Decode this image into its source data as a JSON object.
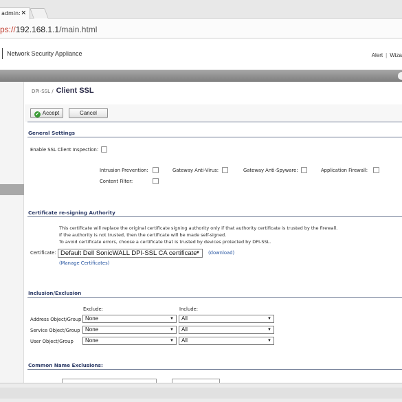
{
  "browser": {
    "tab_title": "admin:",
    "tab_close": "×",
    "url_scheme": "ps://",
    "url_host": "192.168.1.1",
    "url_path": "/main.html"
  },
  "header": {
    "app_title": "Network Security Appliance",
    "link_alert": "Alert",
    "link_separator": "|",
    "link_wizard": "Wiza"
  },
  "breadcrumb": {
    "parent": "DPI-SSL /",
    "current": "Client SSL"
  },
  "toolbar": {
    "accept_label": "Accept",
    "accept_icon": "✔",
    "cancel_label": "Cancel"
  },
  "general_settings": {
    "heading": "General Settings",
    "enable_label": "Enable SSL Client Inspection:",
    "options": [
      "Intrusion Prevention:",
      "Gateway Anti-Virus:",
      "Gateway Anti-Spyware:",
      "Application Firewall:",
      "Content Filter:"
    ]
  },
  "cert_authority": {
    "heading": "Certificate re-signing Authority",
    "lines": [
      "This certificate will replace the original certificate signing authority only if that authority certificate is trusted by the firewall.",
      "If the authority is not trusted, then the certificate will be made self-signed.",
      "To avoid certificate errors, choose a certificate that is trusted by devices protected by DPI-SSL."
    ],
    "certificate_label": "Certificate:",
    "certificate_value": "Default Dell SonicWALL DPI-SSL CA certificate",
    "download_link": "(download)",
    "manage_link": "(Manage Certificates)"
  },
  "inclusion_exclusion": {
    "heading": "Inclusion/Exclusion",
    "exclude_header": "Exclude:",
    "include_header": "Include:",
    "rows": [
      {
        "label": "Address Object/Group",
        "exclude": "None",
        "include": "All"
      },
      {
        "label": "Service Object/Group",
        "exclude": "None",
        "include": "All"
      },
      {
        "label": "User Object/Group",
        "exclude": "None",
        "include": "All"
      }
    ]
  },
  "common_name": {
    "heading": "Common Name Exclusions:"
  },
  "icons": {
    "dropdown": "▼"
  }
}
